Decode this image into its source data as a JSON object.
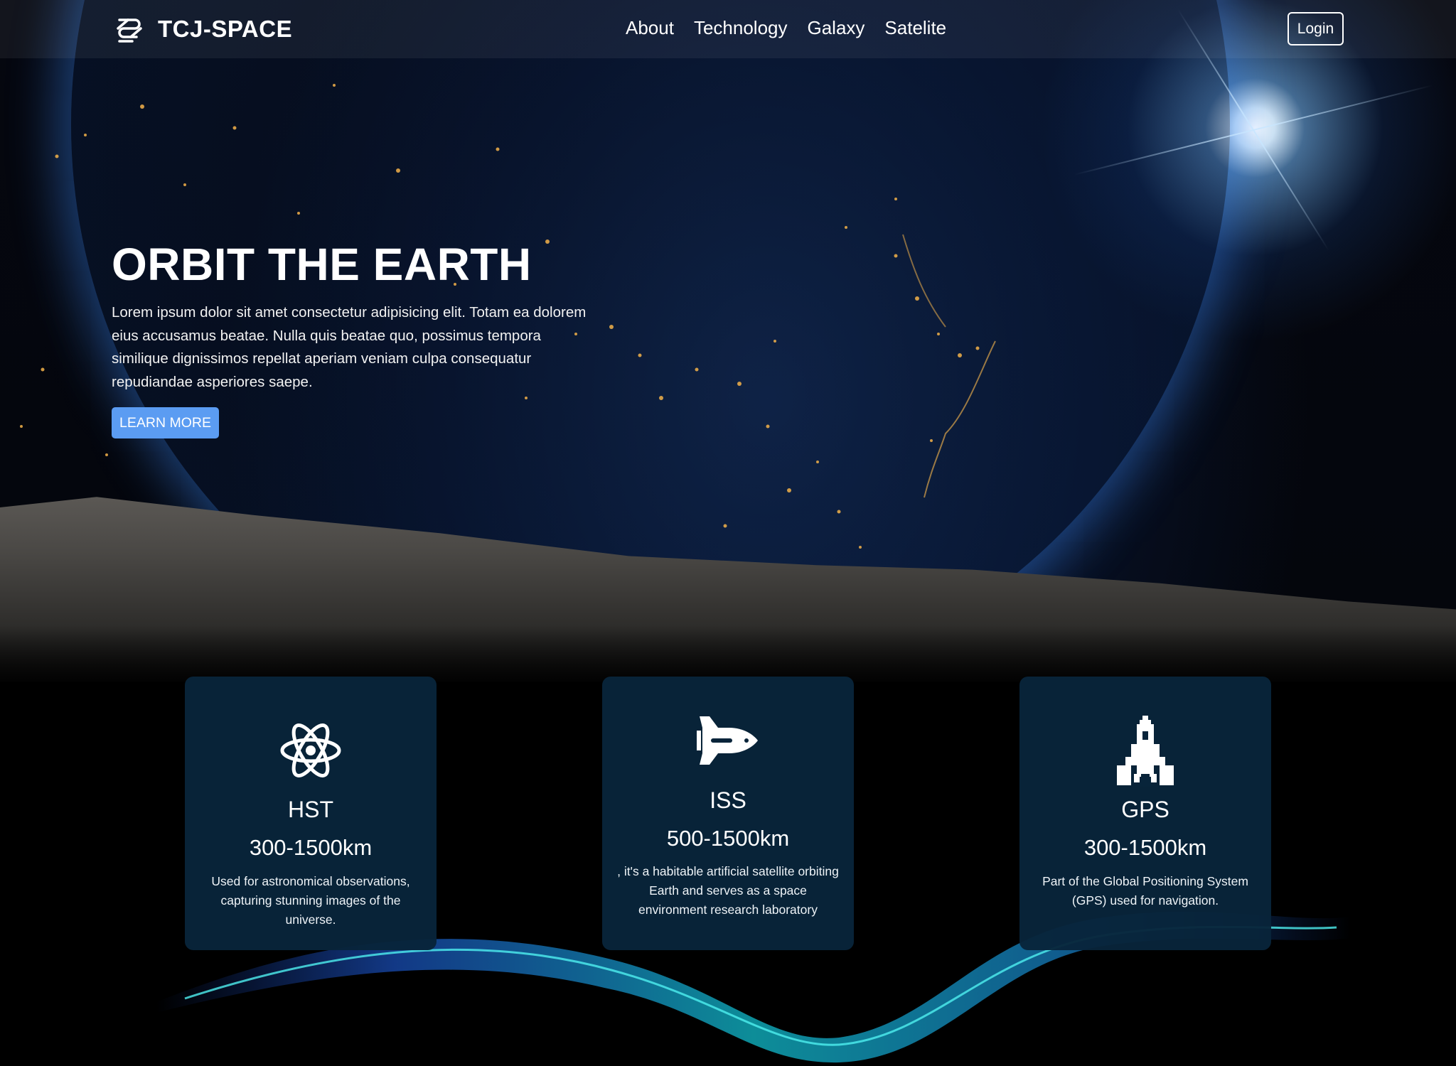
{
  "brand": {
    "name": "TCJ-SPACE",
    "logo_icon": "stacked-wave-logo-icon"
  },
  "nav": {
    "links": [
      "About",
      "Technology",
      "Galaxy",
      "Satelite"
    ],
    "login_label": "Login"
  },
  "hero": {
    "title": "ORBIT THE EARTH",
    "text": "Lorem ipsum dolor sit amet consectetur adipisicing elit. Totam ea dolorem eius accusamus beatae. Nulla quis beatae quo, possimus tempora similique dignissimos repellat aperiam veniam culpa consequatur repudiandae asperiores saepe.",
    "button_label": "LEARN MORE",
    "button_color": "#5b9cf2"
  },
  "cards": [
    {
      "icon": "atom-icon",
      "title": "HST",
      "range": "300-1500km",
      "description": "Used for astronomical observations, capturing stunning images of the universe."
    },
    {
      "icon": "space-shuttle-icon",
      "title": "ISS",
      "range": "500-1500km",
      "description": ", it's a habitable artificial satellite orbiting Earth and serves as a space environment research laboratory"
    },
    {
      "icon": "rocket-icon",
      "title": "GPS",
      "range": "300-1500km",
      "description": "Part of the Global Positioning System (GPS) used for navigation."
    }
  ],
  "colors": {
    "card_background": "#08243a",
    "page_background": "#000000"
  }
}
